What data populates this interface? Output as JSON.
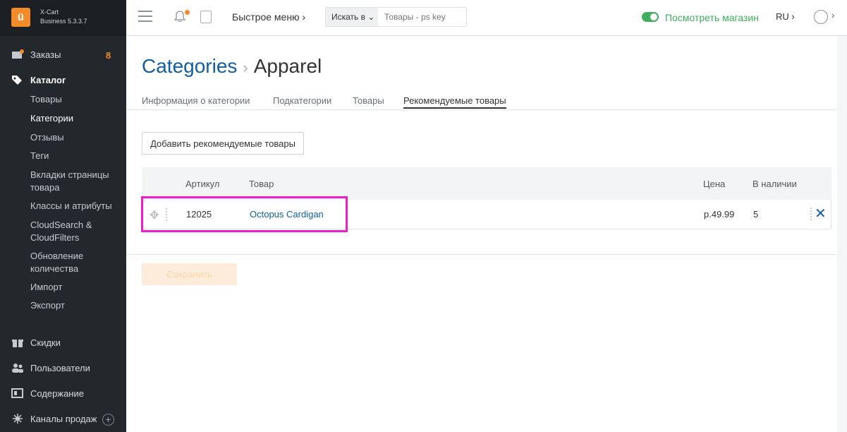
{
  "brand": {
    "name": "X-Cart",
    "edition": "Business 5.3.3.7",
    "logo": "ü"
  },
  "sidebar": {
    "orders_label": "Заказы",
    "orders_count": "8",
    "catalog_label": "Каталог",
    "catalog_items": [
      "Товары",
      "Категории",
      "Отзывы",
      "Теги",
      "Вкладки страницы товара",
      "Классы и атрибуты",
      "CloudSearch & CloudFilters",
      "Обновление количества",
      "Импорт",
      "Экспорт"
    ],
    "discounts_label": "Скидки",
    "users_label": "Пользователи",
    "content_label": "Содержание",
    "channels_label": "Каналы продаж",
    "plus": "+"
  },
  "header": {
    "quick_menu": "Быстрое меню ›",
    "search_in": "Искать в ⌄",
    "search_placeholder": "Товары - ps key",
    "view_store": "Посмотреть магазин",
    "lang": "RU ›",
    "user_chevron": "›"
  },
  "page": {
    "breadcrumb": "Categories",
    "separator": "›",
    "current": "Apparel"
  },
  "tabs": [
    "Информация о категории",
    "Подкатегории",
    "Товары",
    "Рекомендуемые товары"
  ],
  "add_button": "Добавить рекомендуемые товары",
  "table": {
    "headers": {
      "sku": "Артикул",
      "product": "Товар",
      "price": "Цена",
      "stock": "В наличии"
    },
    "rows": [
      {
        "sku": "12025",
        "product": "Octopus Cardigan",
        "price": "р.49.99",
        "stock": "5"
      }
    ]
  },
  "save_button": "Сохранить",
  "colors": {
    "accent": "#115ea3",
    "brand": "#f48b29",
    "highlight": "#f01cd0",
    "store_green": "#3fae5f"
  }
}
